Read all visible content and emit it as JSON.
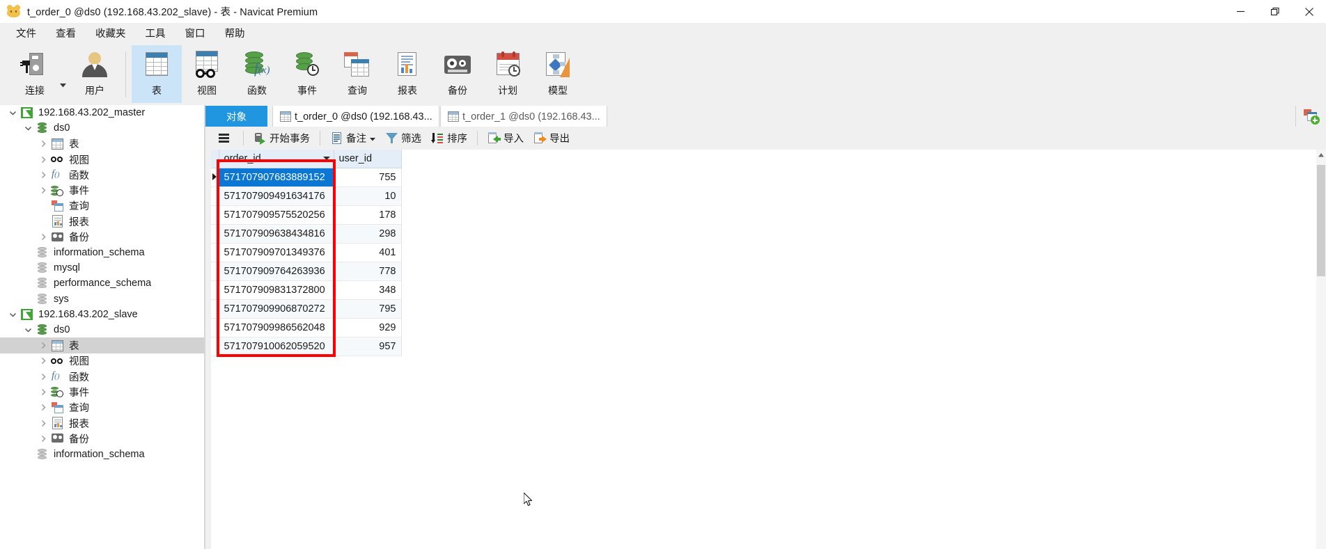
{
  "window": {
    "title": "t_order_0 @ds0 (192.168.43.202_slave) - 表 - Navicat Premium",
    "app_icon": "navicat-icon",
    "minimize_label": "最小化",
    "restore_label": "还原",
    "close_label": "关闭"
  },
  "menubar": {
    "items": [
      {
        "label": "文件"
      },
      {
        "label": "查看"
      },
      {
        "label": "收藏夹"
      },
      {
        "label": "工具"
      },
      {
        "label": "窗口"
      },
      {
        "label": "帮助"
      }
    ]
  },
  "toolbar": {
    "buttons": [
      {
        "label": "连接",
        "icon": "connection-icon",
        "active": false,
        "has_caret": true
      },
      {
        "label": "用户",
        "icon": "user-icon",
        "active": false,
        "has_caret": false
      },
      {
        "label": "表",
        "icon": "table-icon",
        "active": true,
        "has_caret": false
      },
      {
        "label": "视图",
        "icon": "view-icon",
        "active": false,
        "has_caret": false
      },
      {
        "label": "函数",
        "icon": "function-icon",
        "active": false,
        "has_caret": false
      },
      {
        "label": "事件",
        "icon": "event-icon",
        "active": false,
        "has_caret": false
      },
      {
        "label": "查询",
        "icon": "query-icon",
        "active": false,
        "has_caret": false
      },
      {
        "label": "报表",
        "icon": "report-icon",
        "active": false,
        "has_caret": false
      },
      {
        "label": "备份",
        "icon": "backup-icon",
        "active": false,
        "has_caret": false
      },
      {
        "label": "计划",
        "icon": "schedule-icon",
        "active": false,
        "has_caret": false
      },
      {
        "label": "模型",
        "icon": "model-icon",
        "active": false,
        "has_caret": false
      }
    ]
  },
  "sidebar": {
    "rows": [
      {
        "label": "192.168.43.202_master",
        "indent": 0,
        "icon": "connection-icon",
        "twisty": "expanded",
        "selected": false
      },
      {
        "label": "ds0",
        "indent": 1,
        "icon": "database-icon",
        "twisty": "expanded",
        "selected": false
      },
      {
        "label": "表",
        "indent": 2,
        "icon": "table-icon",
        "twisty": "collapsed",
        "selected": false
      },
      {
        "label": "视图",
        "indent": 2,
        "icon": "view-icon",
        "twisty": "collapsed",
        "selected": false
      },
      {
        "label": "函数",
        "indent": 2,
        "icon": "function-icon",
        "twisty": "collapsed",
        "selected": false
      },
      {
        "label": "事件",
        "indent": 2,
        "icon": "event-icon",
        "twisty": "collapsed",
        "selected": false
      },
      {
        "label": "查询",
        "indent": 2,
        "icon": "query-icon",
        "twisty": "none",
        "selected": false
      },
      {
        "label": "报表",
        "indent": 2,
        "icon": "report-icon",
        "twisty": "none",
        "selected": false
      },
      {
        "label": "备份",
        "indent": 2,
        "icon": "backup-icon",
        "twisty": "collapsed",
        "selected": false
      },
      {
        "label": "information_schema",
        "indent": 1,
        "icon": "database-grey-icon",
        "twisty": "none",
        "selected": false
      },
      {
        "label": "mysql",
        "indent": 1,
        "icon": "database-grey-icon",
        "twisty": "none",
        "selected": false
      },
      {
        "label": "performance_schema",
        "indent": 1,
        "icon": "database-grey-icon",
        "twisty": "none",
        "selected": false
      },
      {
        "label": "sys",
        "indent": 1,
        "icon": "database-grey-icon",
        "twisty": "none",
        "selected": false
      },
      {
        "label": "192.168.43.202_slave",
        "indent": 0,
        "icon": "connection-icon",
        "twisty": "expanded",
        "selected": false
      },
      {
        "label": "ds0",
        "indent": 1,
        "icon": "database-icon",
        "twisty": "expanded",
        "selected": false
      },
      {
        "label": "表",
        "indent": 2,
        "icon": "table-icon",
        "twisty": "collapsed",
        "selected": true
      },
      {
        "label": "视图",
        "indent": 2,
        "icon": "view-icon",
        "twisty": "collapsed",
        "selected": false
      },
      {
        "label": "函数",
        "indent": 2,
        "icon": "function-icon",
        "twisty": "collapsed",
        "selected": false
      },
      {
        "label": "事件",
        "indent": 2,
        "icon": "event-icon",
        "twisty": "collapsed",
        "selected": false
      },
      {
        "label": "查询",
        "indent": 2,
        "icon": "query-icon",
        "twisty": "collapsed",
        "selected": false
      },
      {
        "label": "报表",
        "indent": 2,
        "icon": "report-icon",
        "twisty": "collapsed",
        "selected": false
      },
      {
        "label": "备份",
        "indent": 2,
        "icon": "backup-icon",
        "twisty": "collapsed",
        "selected": false
      },
      {
        "label": "information_schema",
        "indent": 1,
        "icon": "database-grey-icon",
        "twisty": "none",
        "selected": false
      }
    ]
  },
  "tabs": {
    "object_tab": {
      "label": "对象",
      "active": false
    },
    "documents": [
      {
        "label": "t_order_0 @ds0 (192.168.43...",
        "icon": "table-icon",
        "active": true
      },
      {
        "label": "t_order_1 @ds0 (192.168.43...",
        "icon": "table-icon",
        "active": false
      }
    ],
    "new_tab_icon": "new-query-icon"
  },
  "action_toolbar": {
    "buttons": [
      {
        "label": "",
        "icon": "hamburger-icon",
        "caret": false
      },
      {
        "label": "开始事务",
        "icon": "begin-transaction-icon",
        "caret": false
      },
      {
        "label": "备注",
        "icon": "note-icon",
        "caret": true
      },
      {
        "label": "筛选",
        "icon": "filter-icon",
        "caret": false
      },
      {
        "label": "排序",
        "icon": "sort-icon",
        "caret": false
      },
      {
        "label": "导入",
        "icon": "import-icon",
        "caret": false
      },
      {
        "label": "导出",
        "icon": "export-icon",
        "caret": false
      }
    ]
  },
  "grid": {
    "columns": [
      {
        "name": "order_id",
        "width": 165,
        "has_dropdown": true,
        "align": "left"
      },
      {
        "name": "user_id",
        "width": 97,
        "has_dropdown": false,
        "align": "right"
      }
    ],
    "rows": [
      {
        "order_id": "571707907683889152",
        "user_id": "755",
        "selected": true
      },
      {
        "order_id": "571707909491634176",
        "user_id": "10",
        "selected": false
      },
      {
        "order_id": "571707909575520256",
        "user_id": "178",
        "selected": false
      },
      {
        "order_id": "571707909638434816",
        "user_id": "298",
        "selected": false
      },
      {
        "order_id": "571707909701349376",
        "user_id": "401",
        "selected": false
      },
      {
        "order_id": "571707909764263936",
        "user_id": "778",
        "selected": false
      },
      {
        "order_id": "571707909831372800",
        "user_id": "348",
        "selected": false
      },
      {
        "order_id": "571707909906870272",
        "user_id": "795",
        "selected": false
      },
      {
        "order_id": "571707909986562048",
        "user_id": "929",
        "selected": false
      },
      {
        "order_id": "571707910062059520",
        "user_id": "957",
        "selected": false
      }
    ]
  },
  "annotation": {
    "color": "#ff0000",
    "shape": "rectangle"
  },
  "colors": {
    "accent": "#2196e0",
    "selection": "#0b77d4",
    "toolbar_active": "#cce4f7",
    "header": "#e4eef8",
    "tree_selected": "#d2d2d2"
  }
}
